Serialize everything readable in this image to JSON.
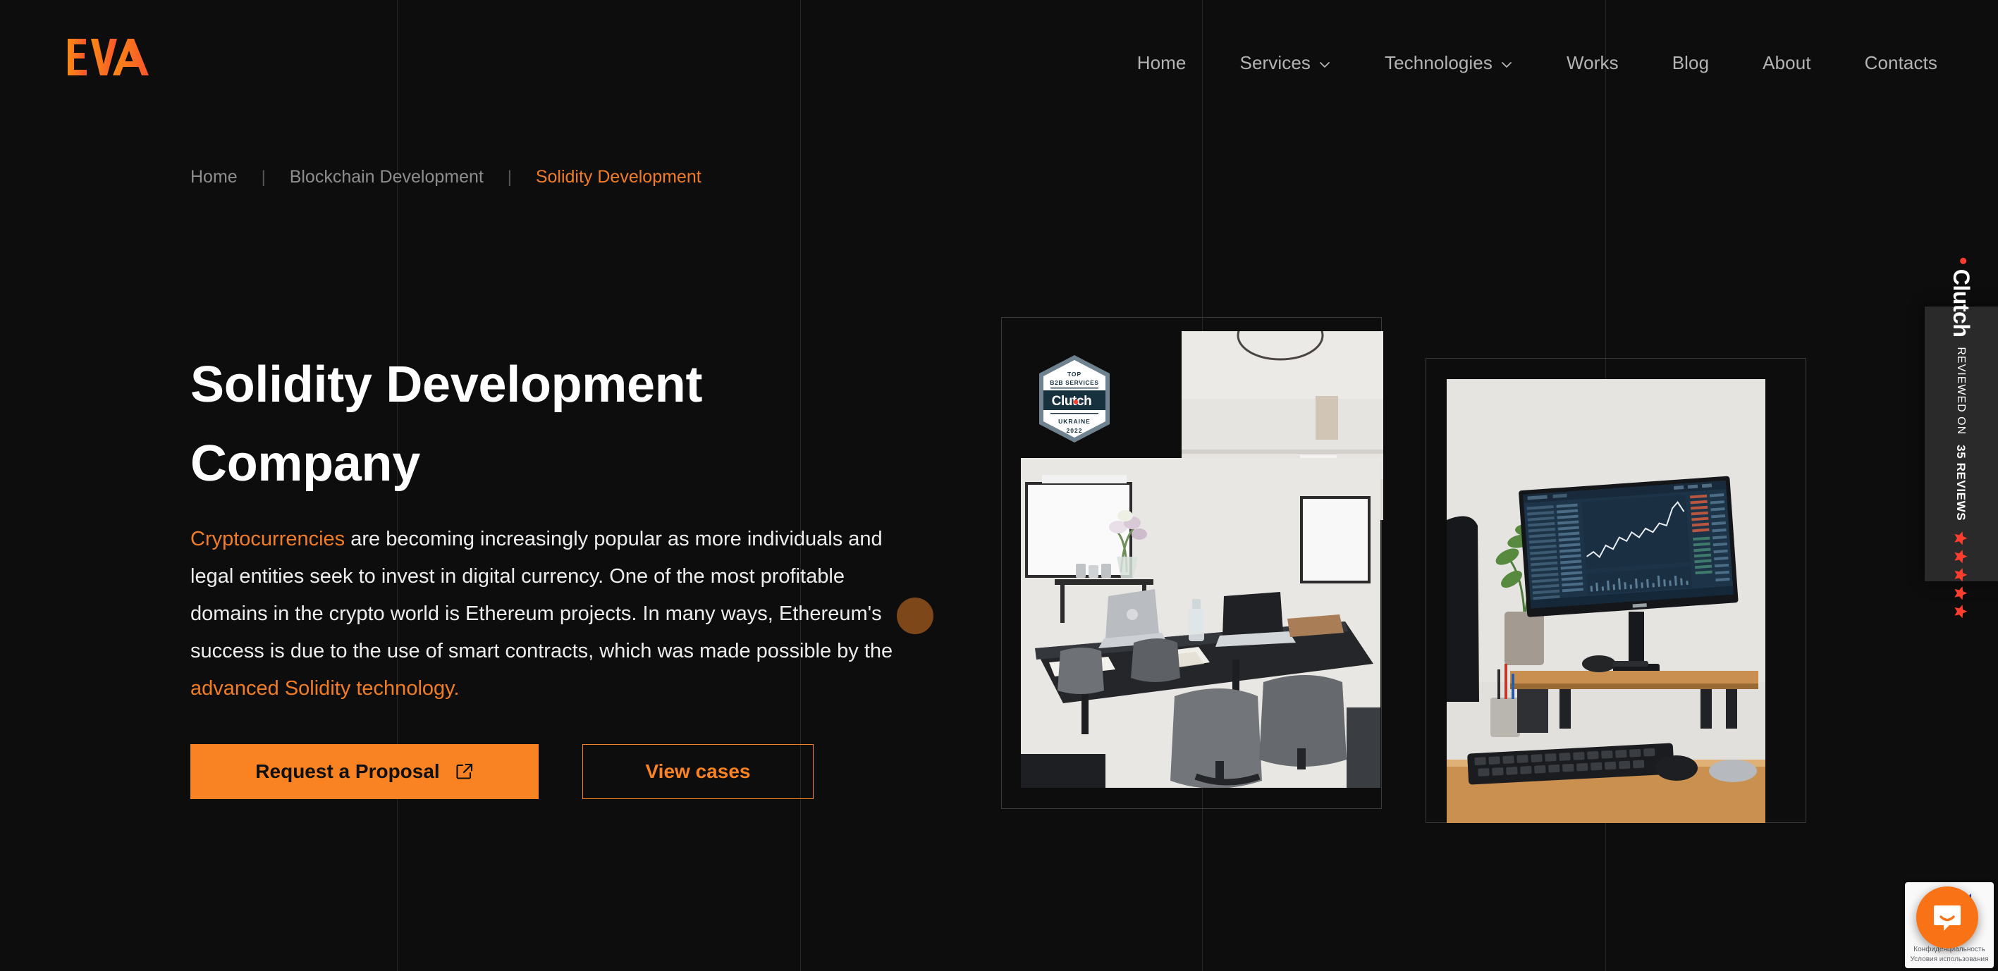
{
  "brand": {
    "logo_text": "EVA",
    "accent_color": "#f98222",
    "accent_color_alt": "#f07d26",
    "background_color": "#0d0d0d"
  },
  "nav": {
    "items": [
      {
        "label": "Home",
        "has_dropdown": false
      },
      {
        "label": "Services",
        "has_dropdown": true,
        "icon": "chevron-down-icon"
      },
      {
        "label": "Technologies",
        "has_dropdown": true,
        "icon": "chevron-down-icon"
      },
      {
        "label": "Works",
        "has_dropdown": false
      },
      {
        "label": "Blog",
        "has_dropdown": false
      },
      {
        "label": "About",
        "has_dropdown": false
      },
      {
        "label": "Contacts",
        "has_dropdown": false
      }
    ]
  },
  "breadcrumb": {
    "separator": "|",
    "items": [
      {
        "label": "Home",
        "current": false
      },
      {
        "label": "Blockchain Development",
        "current": false
      },
      {
        "label": "Solidity Development",
        "current": true
      }
    ]
  },
  "hero": {
    "title": "Solidity Development Company",
    "paragraph": {
      "lead_link": "Cryptocurrencies",
      "body_1": " are becoming increasingly popular as more individuals and legal entities seek to invest in digital currency. One of the most profitable domains in the crypto world is Ethereum projects. In many ways, Ethereum's success is due to the use of smart contracts, which was made possible by the ",
      "tail_link": "advanced Solidity technology."
    },
    "primary_button": {
      "label": "Request a Proposal",
      "icon": "external-link-icon"
    },
    "secondary_button": {
      "label": "View cases"
    }
  },
  "clutch_badge": {
    "top_label": "TOP",
    "category": "B2B SERVICES",
    "brand": "Clutch",
    "country": "UKRAINE",
    "year": "2022"
  },
  "reviews_widget": {
    "reviewed_on": "REVIEWED ON",
    "brand": "Clutch",
    "count_label": "35 REVIEWS",
    "stars": 5,
    "star_color": "#ff3d2e"
  },
  "recaptcha": {
    "privacy_label": "Конфиденциальность",
    "terms_label": "Условия использования"
  },
  "chat": {
    "icon": "chat-bubble-icon",
    "color": "#f97316"
  },
  "decor": {
    "grid_line_positions": [
      563,
      1135,
      1705,
      2277
    ],
    "accent_dot_color": "#7d4719"
  }
}
